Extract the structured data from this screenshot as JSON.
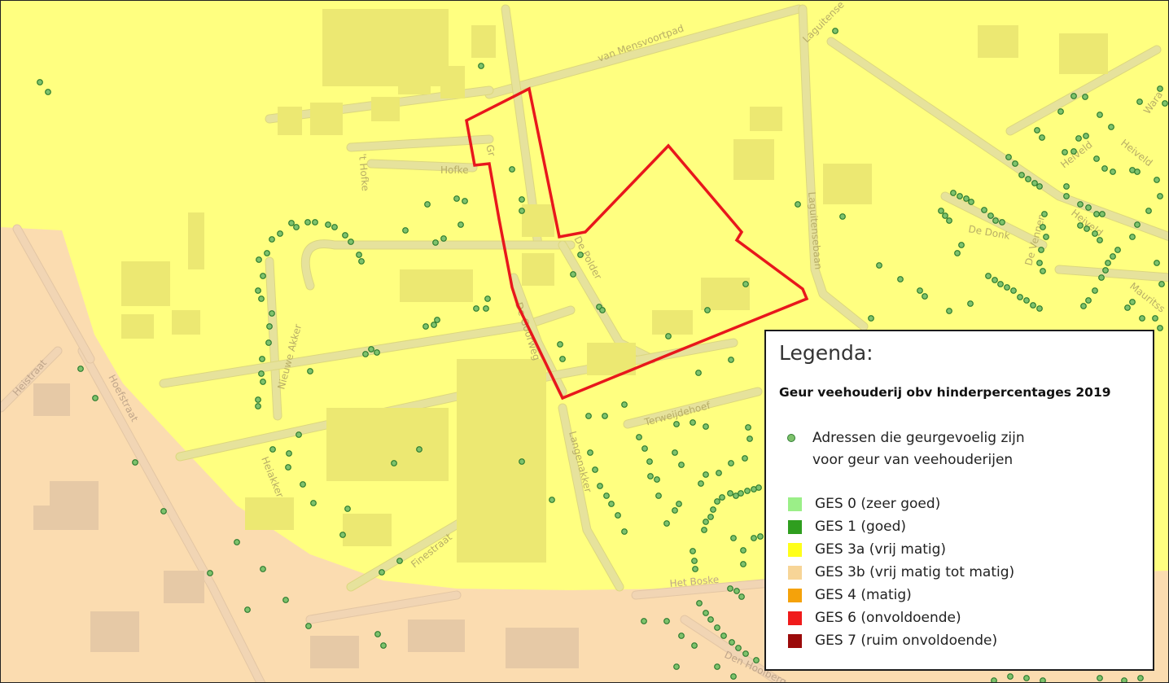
{
  "map": {
    "streets": {
      "van_mensvoortpad": "van Mensvoortpad",
      "laguitensebaan_top": "Laguitense",
      "laguitensebaan": "Laguitensebaan",
      "hofke": "Hofke",
      "t_hofke": "'t Hofke",
      "graafschaplaan": "Gr",
      "de_polder": "De Polder",
      "de_goorweg": "De Goorweg",
      "nieuwe_akker": "Nieuwe Akker",
      "heistraat": "Heistraat",
      "hoefstraat": "Hoefstraat",
      "heiakker": "Heiakker",
      "finestraat": "Finestraat",
      "langenakker": "Langenakker",
      "terweijdehoef": "Terweijdehoef",
      "het_boske": "Het Boske",
      "den_hoolberg": "Den Hoolberg",
      "heiveld_1": "Heiveld",
      "heiveld_2": "Heiveld",
      "heiveld_3": "Heiveld",
      "de_donk": "De Donk",
      "de_vennen": "De Vennen",
      "warande": "Wara",
      "mauritsstraat": "Mauritss"
    },
    "colors": {
      "zone_ges3a": "#ffff80",
      "zone_ges3b": "#fbdcb0",
      "plan_boundary": "#e8171c",
      "address_dot_fill": "#7ec26c",
      "address_dot_stroke": "#2f7d31"
    }
  },
  "legend": {
    "title": "Legenda:",
    "subtitle": "Geur veehouderij obv hinderpercentages 2019",
    "address_line1": "Adressen die geurgevoelig zijn",
    "address_line2": "voor geur van veehouderijen",
    "classes": [
      {
        "label": "GES 0 (zeer goed)",
        "color": "#9bef88"
      },
      {
        "label": "GES 1 (goed)",
        "color": "#2f9e1f"
      },
      {
        "label": "GES 3a (vrij matig)",
        "color": "#ffff1a"
      },
      {
        "label": "GES 3b (vrij matig tot matig)",
        "color": "#f7d597"
      },
      {
        "label": "GES 4 (matig)",
        "color": "#f5a20a"
      },
      {
        "label": "GES 6 (onvoldoende)",
        "color": "#f01b1b"
      },
      {
        "label": "GES 7 (ruim onvoldoende)",
        "color": "#9b0a0a"
      }
    ]
  }
}
